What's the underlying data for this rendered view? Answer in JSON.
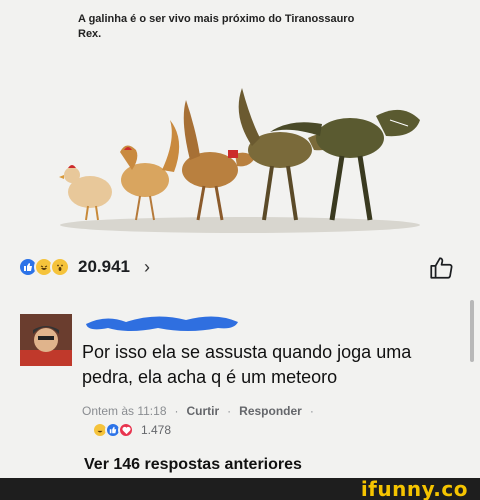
{
  "post": {
    "caption": "A galinha é o ser vivo mais próximo do Tiranossauro Rex."
  },
  "reactions": {
    "icons": [
      "like-icon",
      "haha-icon",
      "wow-icon"
    ],
    "count": "20.941",
    "chevron": "›"
  },
  "comment": {
    "text": "Por isso ela se assusta quando joga uma pedra, ela acha q é um meteoro",
    "time": "Ontem às 11:18",
    "separator": "·",
    "like_action": "Curtir",
    "reply_action": "Responder",
    "reaction_icons": [
      "haha-icon",
      "like-icon",
      "love-icon"
    ],
    "reaction_count": "1.478"
  },
  "more_replies": "Ver 146 respostas anteriores",
  "watermark": "ifunny.co",
  "colors": {
    "like_blue": "#2c73e8",
    "haha_yellow": "#f5c33b",
    "love_red": "#e8344e",
    "redaction_blue": "#2f6fe0",
    "watermark_yellow": "#f5c400"
  }
}
